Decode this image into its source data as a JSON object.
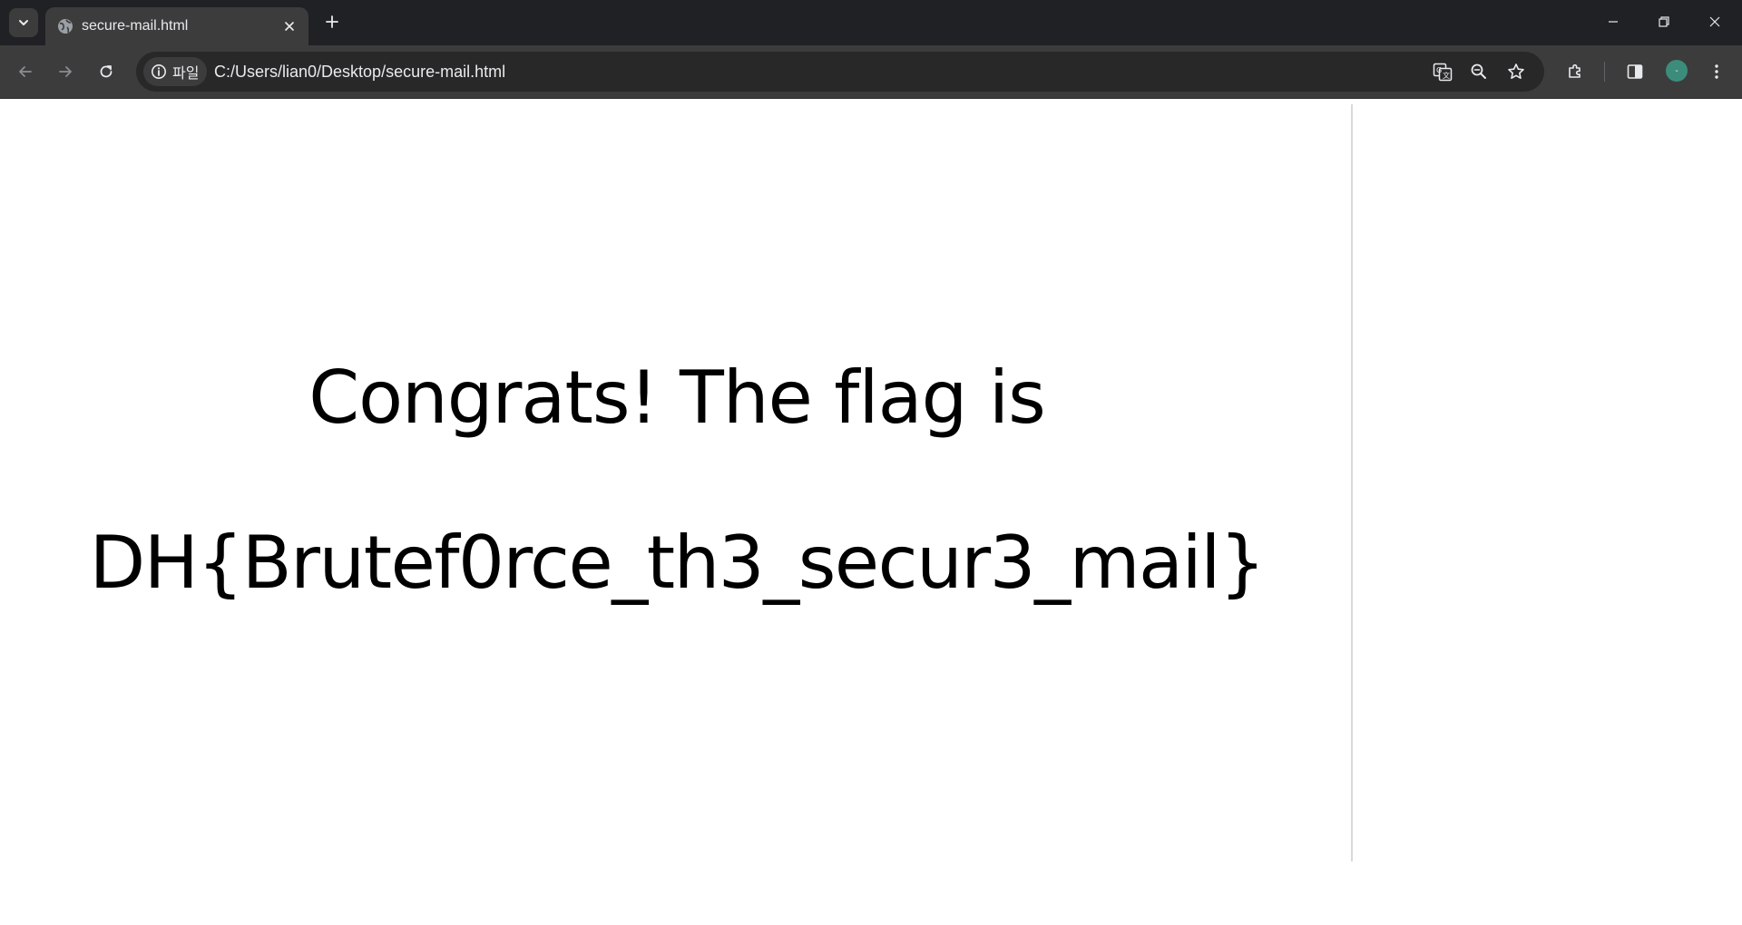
{
  "tab": {
    "title": "secure-mail.html",
    "favicon": "globe-icon"
  },
  "omnibox": {
    "site_info_label": "파일",
    "url": "C:/Users/lian0/Desktop/secure-mail.html"
  },
  "profile": {
    "avatar_text": "-",
    "avatar_color": "#3c8c7c"
  },
  "page": {
    "message": "Congrats! The flag is",
    "flag": "DH{Brutef0rce_th3_secur3_mail}"
  },
  "theme": {
    "tabstrip_bg": "#202124",
    "toolbar_bg": "#3c3c3c",
    "omnibox_bg": "#282828",
    "text_light": "#e8eaed"
  }
}
